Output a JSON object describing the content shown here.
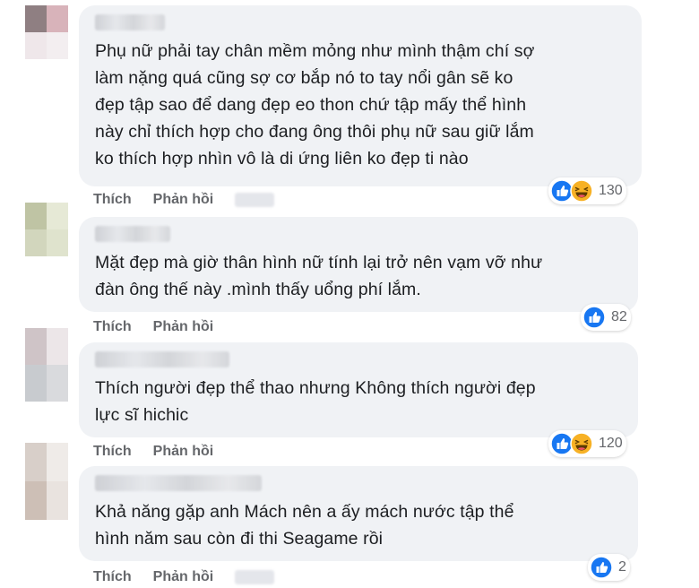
{
  "comments": [
    {
      "text_lines": [
        "Phụ nữ phải tay chân mềm mỏng như mình thậm chí sợ",
        "làm nặng quá cũng sợ cơ bắp nó to tay nổi gân sẽ ko",
        "đẹp tập sao để dang đẹp eo thon chứ tập mấy thể hình",
        "này chỉ thích hợp cho đang ông thôi phụ nữ sau giữ lắm",
        "ko thích hợp nhìn vô là di ứng liên ko đẹp ti nào"
      ],
      "like_label": "Thích",
      "reply_label": "Phản hồi",
      "reactions": [
        "like",
        "haha"
      ],
      "reaction_count": "130"
    },
    {
      "text_lines": [
        "Mặt đẹp mà giờ thân hình nữ tính lại trở nên vạm vỡ như",
        "đàn ông thế này .mình thấy uổng phí lắm."
      ],
      "like_label": "Thích",
      "reply_label": "Phản hồi",
      "reactions": [
        "like"
      ],
      "reaction_count": "82"
    },
    {
      "text_lines": [
        "Thích người đẹp thể thao nhưng Không thích người đẹp",
        "lực sĩ hichic"
      ],
      "like_label": "Thích",
      "reply_label": "Phản hồi",
      "reactions": [
        "like",
        "haha"
      ],
      "reaction_count": "120"
    },
    {
      "text_lines": [
        "Khả năng gặp anh Mách nên a ấy mách nước tập thể",
        "hình năm sau còn đi thi Seagame rồi"
      ],
      "like_label": "Thích",
      "reply_label": "Phản hồi",
      "reactions": [
        "like"
      ],
      "reaction_count": "2"
    }
  ],
  "colors": {
    "bubble": "#f0f2f5",
    "like_blue": "#1877f2",
    "haha_yellow": "#f7b125",
    "action_gray": "#65676b"
  }
}
